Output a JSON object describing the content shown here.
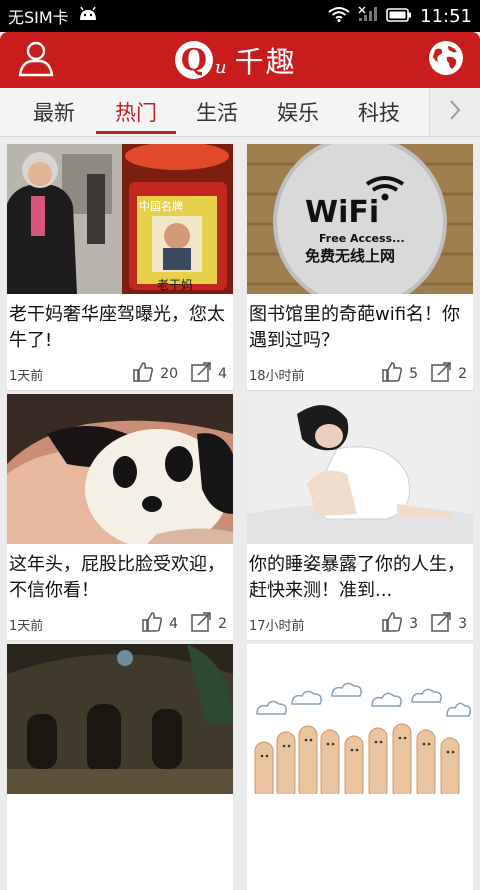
{
  "status_bar": {
    "carrier": "无SIM卡",
    "time": "11:51"
  },
  "header": {
    "logo_mark": "Q",
    "logo_sub": "u",
    "app_name": "千趣"
  },
  "tabs": [
    {
      "label": "最新"
    },
    {
      "label": "热门"
    },
    {
      "label": "生活"
    },
    {
      "label": "娱乐"
    },
    {
      "label": "科技"
    }
  ],
  "articles": [
    {
      "title": "老干妈奢华座驾曝光，您太牛了!",
      "time": "1天前",
      "likes": "20",
      "shares": "4",
      "image_text": {
        "brand": "老干妈",
        "badge": "中国名牌"
      }
    },
    {
      "title": "图书馆里的奇葩wifi名！你遇到过吗？",
      "time": "18小时前",
      "likes": "5",
      "shares": "2",
      "image_text": {
        "wifi": "WiFi",
        "free": "Free Access...",
        "cn": "免费无线上网"
      }
    },
    {
      "title": "这年头，屁股比脸受欢迎，不信你看！",
      "time": "1天前",
      "likes": "4",
      "shares": "2"
    },
    {
      "title": "你的睡姿暴露了你的人生，赶快来测！准到...",
      "time": "17小时前",
      "likes": "3",
      "shares": "3"
    },
    {
      "title": "",
      "time": "",
      "likes": "",
      "shares": ""
    },
    {
      "title": "",
      "time": "",
      "likes": "",
      "shares": ""
    }
  ],
  "colors": {
    "brand_red": "#c91d1d",
    "tab_active": "#c91d1d",
    "background": "#ececec"
  }
}
